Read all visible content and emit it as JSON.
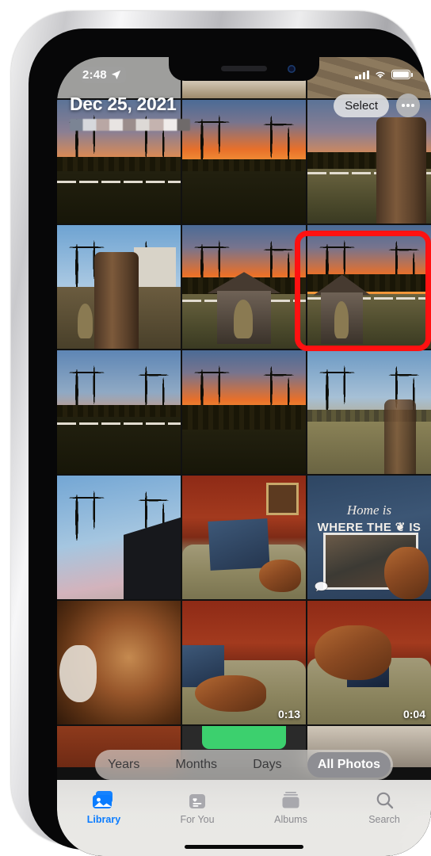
{
  "device": {
    "name": "iphone",
    "home_indicator": true
  },
  "status_bar": {
    "time": "2:48",
    "location_icon": "location-arrow-icon",
    "cellular_icon": "cellular-bars-icon",
    "wifi_icon": "wifi-icon",
    "battery_icon": "battery-icon"
  },
  "header": {
    "title": "Dec 25, 2021",
    "subtitle_redacted": true,
    "select_label": "Select",
    "more_icon": "ellipsis-icon"
  },
  "annotation": {
    "type": "highlight-rectangle",
    "color": "#ff1111",
    "target": "photo-row2-col3"
  },
  "grid": {
    "columns": 3,
    "rows": [
      {
        "partial": true,
        "cells": [
          {
            "name": "photo-row0-col1",
            "scene": "blank-gray",
            "label": ""
          },
          {
            "name": "photo-row0-col2",
            "scene": "lace-table",
            "label": ""
          },
          {
            "name": "photo-row0-col3",
            "scene": "wood-deck",
            "label": ""
          }
        ]
      },
      {
        "cells": [
          {
            "name": "photo-row1-col1",
            "scene": "sunset-field",
            "label": ""
          },
          {
            "name": "photo-row1-col2",
            "scene": "sunset-trees",
            "label": ""
          },
          {
            "name": "photo-row1-col3",
            "scene": "tree-trunk-sunset",
            "label": ""
          }
        ]
      },
      {
        "cells": [
          {
            "name": "photo-row2-col1",
            "scene": "tree-trunk-house",
            "label": ""
          },
          {
            "name": "photo-row2-col2",
            "scene": "shrine-sunset",
            "label": ""
          },
          {
            "name": "photo-row2-col3",
            "scene": "shrine-fence-sunset",
            "label": ""
          }
        ]
      },
      {
        "cells": [
          {
            "name": "photo-row3-col1",
            "scene": "sunset-pasture",
            "label": ""
          },
          {
            "name": "photo-row3-col2",
            "scene": "sunset-treeline",
            "label": ""
          },
          {
            "name": "photo-row3-col3",
            "scene": "yard-big-tree",
            "label": ""
          }
        ]
      },
      {
        "cells": [
          {
            "name": "photo-row4-col1",
            "scene": "tree-sky-roof",
            "label": ""
          },
          {
            "name": "photo-row4-col2",
            "scene": "red-room-dog-blanket",
            "label": ""
          },
          {
            "name": "photo-row4-col3",
            "scene": "photo-blanket",
            "label": "",
            "badge_bubble": true,
            "blanket_text_line1": "Home is",
            "blanket_text_line2": "WHERE THE ❦ IS"
          }
        ]
      },
      {
        "cells": [
          {
            "name": "photo-row5-col1",
            "scene": "dog-closeup",
            "label": ""
          },
          {
            "name": "photo-row5-col2",
            "scene": "dog-couch-video",
            "label": "",
            "duration": "0:13"
          },
          {
            "name": "photo-row5-col3",
            "scene": "dogs-couch-video",
            "label": "",
            "duration": "0:04"
          }
        ]
      },
      {
        "partial": true,
        "cells": [
          {
            "name": "photo-row6-col1",
            "scene": "red-wall-partial",
            "label": ""
          },
          {
            "name": "photo-row6-col2",
            "scene": "green-screen-partial",
            "label": ""
          },
          {
            "name": "photo-row6-col3",
            "scene": "indoor-partial",
            "label": ""
          }
        ]
      }
    ]
  },
  "segmented_control": {
    "options": [
      "Years",
      "Months",
      "Days",
      "All Photos"
    ],
    "selected": "All Photos"
  },
  "tab_bar": {
    "tabs": [
      {
        "label": "Library",
        "icon": "photo-stack-icon",
        "active": true
      },
      {
        "label": "For You",
        "icon": "for-you-card-icon",
        "active": false
      },
      {
        "label": "Albums",
        "icon": "albums-stack-icon",
        "active": false
      },
      {
        "label": "Search",
        "icon": "magnifier-icon",
        "active": false
      }
    ],
    "active_color": "#0a7cff",
    "inactive_color": "#8b8b90"
  }
}
